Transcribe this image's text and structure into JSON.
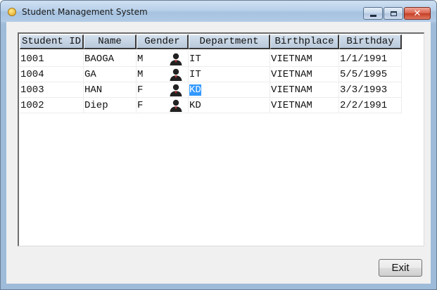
{
  "window": {
    "title": "Student Management System",
    "close_glyph": "✕"
  },
  "table": {
    "columns": [
      "Student ID",
      "Name",
      "Gender",
      "Department",
      "Birthplace",
      "Birthday"
    ],
    "rows": [
      {
        "student_id": "1001",
        "name": "BAOGA",
        "gender": "M",
        "department": "IT",
        "birthplace": "VIETNAM",
        "birthday": "1/1/1991"
      },
      {
        "student_id": "1004",
        "name": "GA",
        "gender": "M",
        "department": "IT",
        "birthplace": "VIETNAM",
        "birthday": "5/5/1995"
      },
      {
        "student_id": "1003",
        "name": "HAN",
        "gender": "F",
        "department": "KD",
        "birthplace": "VIETNAM",
        "birthday": "3/3/1993"
      },
      {
        "student_id": "1002",
        "name": "Diep",
        "gender": "F",
        "department": "KD",
        "birthplace": "VIETNAM",
        "birthday": "2/2/1991"
      }
    ],
    "selected_cell": {
      "row": 2,
      "column": "department"
    },
    "row_icon": "person-icon"
  },
  "buttons": {
    "exit_label": "Exit"
  },
  "colors": {
    "selection": "#3399ff",
    "close_button": "#c43d25"
  }
}
